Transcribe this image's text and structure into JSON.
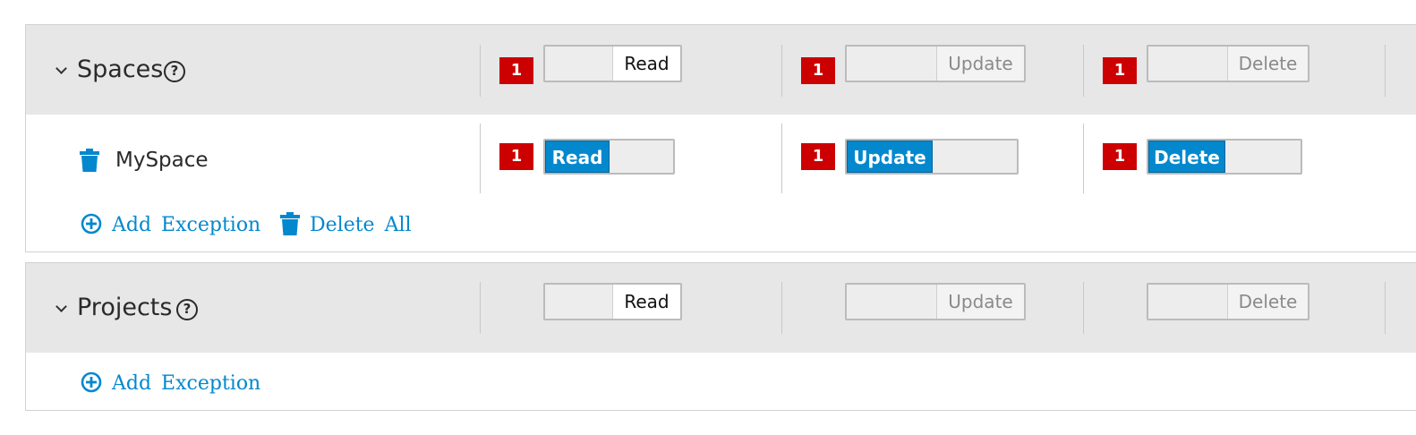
{
  "colors": {
    "accent": "#0388ce",
    "badge": "#cc0000",
    "header_bg": "#e7e7e7"
  },
  "sections": [
    {
      "title": "Spaces",
      "help_icon": "question-circle-icon",
      "collapse_icon": "chevron-down-icon",
      "header": {
        "read": {
          "badge": "1",
          "label": "Read",
          "enabled": false
        },
        "update": {
          "badge": "1",
          "label": "Update",
          "enabled": false
        },
        "delete": {
          "badge": "1",
          "label": "Delete",
          "enabled": false
        }
      },
      "exceptions": [
        {
          "name": "MySpace",
          "remove_icon": "trash-icon",
          "read": {
            "badge": "1",
            "label": "Read",
            "enabled": true
          },
          "update": {
            "badge": "1",
            "label": "Update",
            "enabled": true
          },
          "delete": {
            "badge": "1",
            "label": "Delete",
            "enabled": true
          }
        }
      ],
      "actions": {
        "add": "Add Exception",
        "delete_all": "Delete All"
      }
    },
    {
      "title": "Projects",
      "help_icon": "question-circle-icon",
      "collapse_icon": "chevron-down-icon",
      "header": {
        "read": {
          "label": "Read",
          "enabled": false
        },
        "update": {
          "label": "Update",
          "enabled": false
        },
        "delete": {
          "label": "Delete",
          "enabled": false
        }
      },
      "actions": {
        "add": "Add Exception"
      }
    }
  ]
}
